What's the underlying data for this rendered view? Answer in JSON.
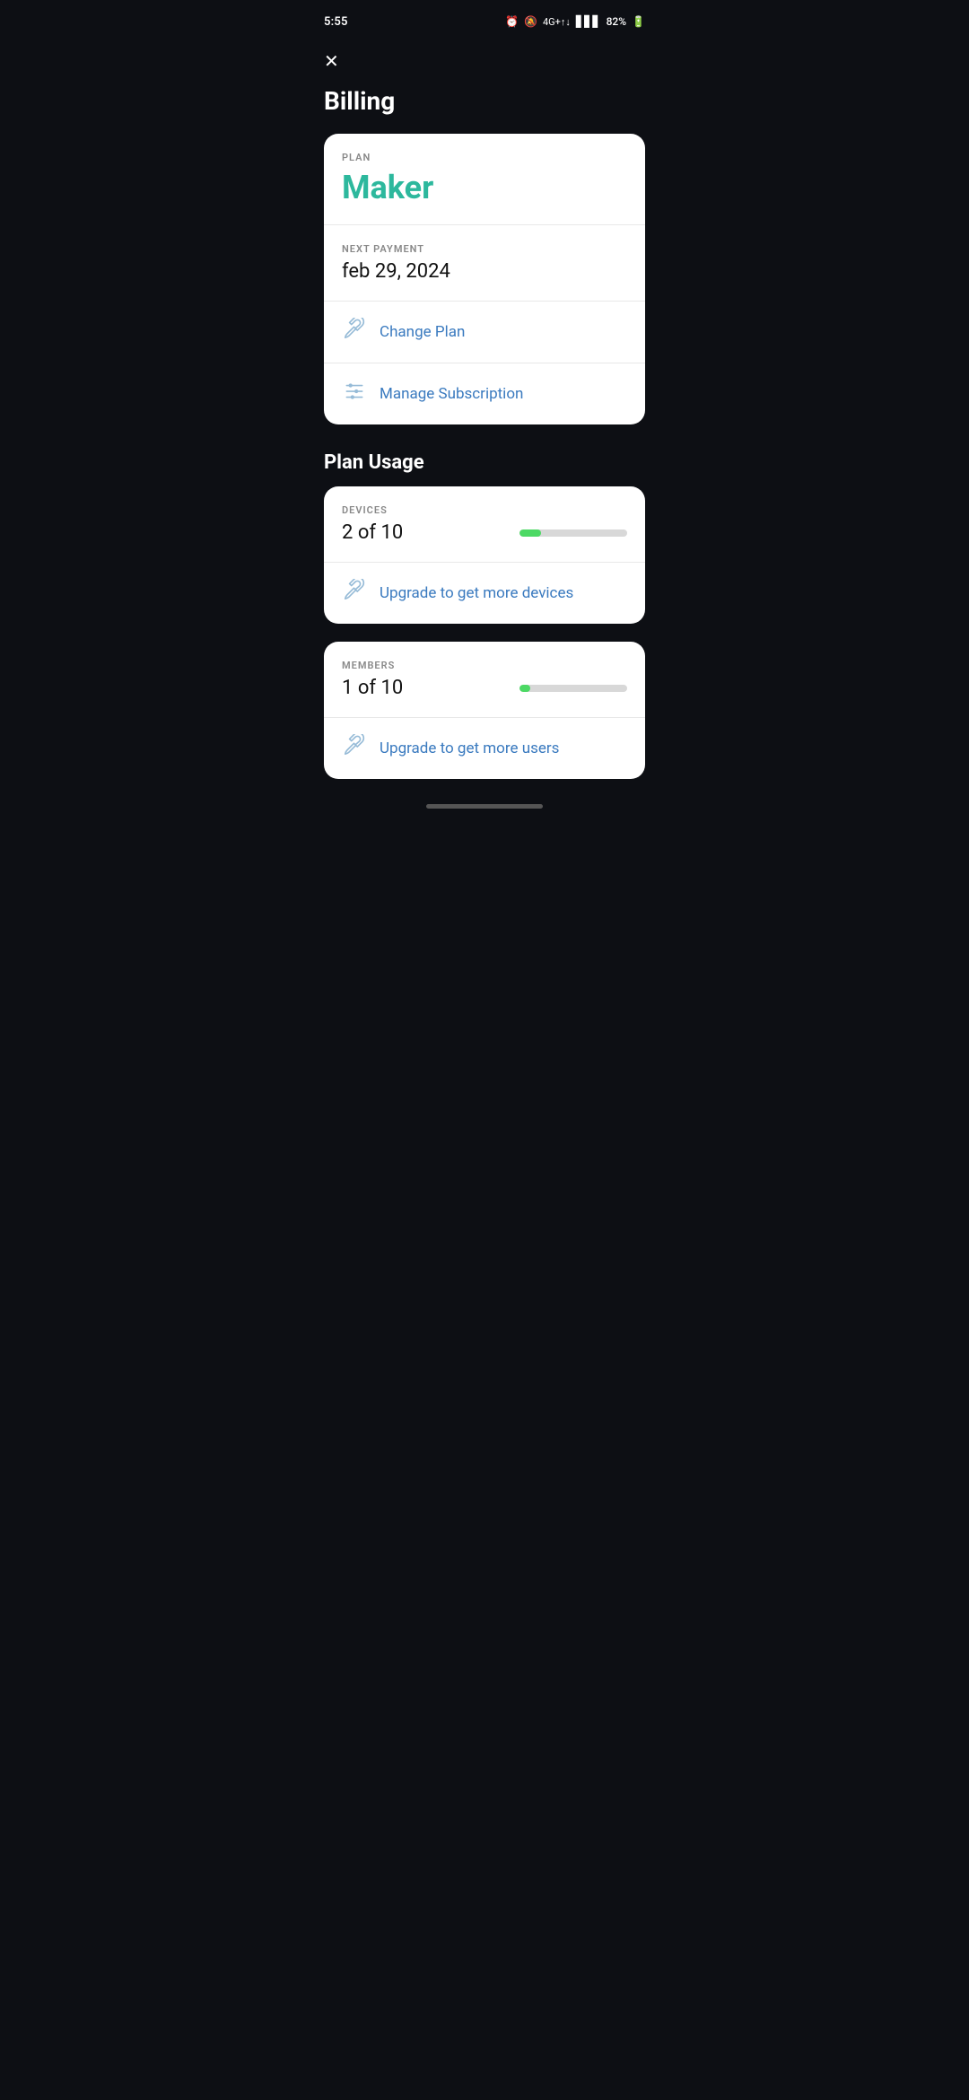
{
  "statusBar": {
    "time": "5:55",
    "battery": "82%",
    "signal": "4G+"
  },
  "header": {
    "title": "Billing"
  },
  "planCard": {
    "planLabel": "PLAN",
    "planName": "Maker",
    "nextPaymentLabel": "NEXT PAYMENT",
    "nextPaymentDate": "feb 29, 2024",
    "changePlanLabel": "Change Plan",
    "manageSubscriptionLabel": "Manage Subscription"
  },
  "planUsage": {
    "sectionTitle": "Plan Usage",
    "devices": {
      "label": "DEVICES",
      "used": 2,
      "total": 10,
      "display": "2 of 10",
      "progressPercent": 20,
      "upgradeLabel": "Upgrade to get more devices"
    },
    "members": {
      "label": "MEMBERS",
      "used": 1,
      "total": 10,
      "display": "1 of 10",
      "progressPercent": 10,
      "upgradeLabel": "Upgrade to get more users"
    }
  }
}
